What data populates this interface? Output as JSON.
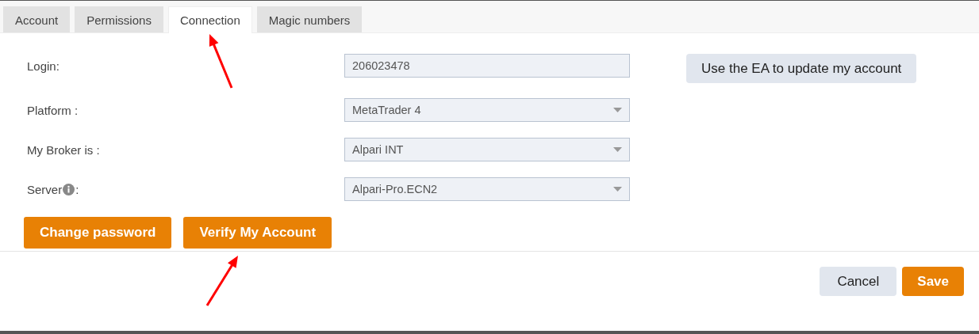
{
  "tabs": [
    {
      "label": "Account",
      "selected": false
    },
    {
      "label": "Permissions",
      "selected": false
    },
    {
      "label": "Connection",
      "selected": true
    },
    {
      "label": "Magic numbers",
      "selected": false
    }
  ],
  "fields": [
    {
      "kind": "text",
      "label": "Login:",
      "value": "206023478",
      "info": false
    },
    {
      "kind": "select",
      "label": "Platform :",
      "value": "MetaTrader 4",
      "info": false
    },
    {
      "kind": "select",
      "label": "My Broker is :",
      "value": "Alpari INT",
      "info": false
    },
    {
      "kind": "select",
      "label": "Server ",
      "label_end": ":",
      "value": "Alpari-Pro.ECN2",
      "info": true
    }
  ],
  "side_button": "Use the EA to update my account",
  "actions": [
    "Change password",
    "Verify My Account"
  ],
  "footer": [
    {
      "label": "Cancel",
      "kind": "secondary"
    },
    {
      "label": "Save",
      "kind": "primary"
    }
  ]
}
